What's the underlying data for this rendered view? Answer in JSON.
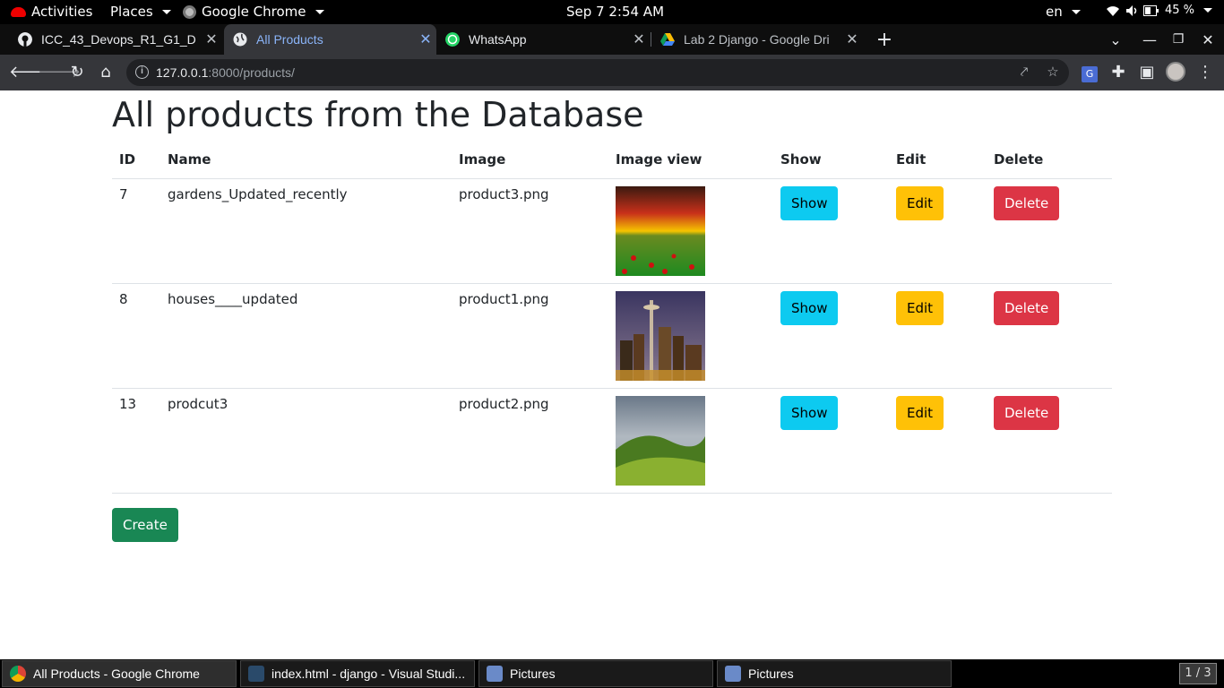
{
  "system_bar": {
    "activities": "Activities",
    "places": "Places",
    "app": "Google Chrome",
    "datetime": "Sep 7   2:54 AM",
    "language": "en",
    "battery": "45 %"
  },
  "tabs": [
    {
      "title": "ICC_43_Devops_R1_G1_D",
      "icon": "github-icon",
      "active": false
    },
    {
      "title": "All Products",
      "icon": "globe-icon",
      "active": true
    },
    {
      "title": "WhatsApp",
      "icon": "whatsapp-icon",
      "active": false
    },
    {
      "title": "Lab 2 Django - Google Dri",
      "icon": "google-drive-icon",
      "active": false
    }
  ],
  "address_bar": {
    "host": "127.0.0.1",
    "path": ":8000/products/"
  },
  "page": {
    "heading": "All products from the Database",
    "columns": [
      "ID",
      "Name",
      "Image",
      "Image view",
      "Show",
      "Edit",
      "Delete"
    ],
    "rows": [
      {
        "id": "7",
        "name": "gardens_Updated_recently",
        "image": "product3.png",
        "thumb": "sunset-poppy-field"
      },
      {
        "id": "8",
        "name": "houses____updated",
        "image": "product1.png",
        "thumb": "city-skyline-night"
      },
      {
        "id": "13",
        "name": "prodcut3",
        "image": "product2.png",
        "thumb": "green-hills"
      }
    ],
    "show_label": "Show",
    "edit_label": "Edit",
    "delete_label": "Delete",
    "create_label": "Create"
  },
  "taskbar": {
    "items": [
      {
        "label": "All Products - Google Chrome",
        "active": true
      },
      {
        "label": "index.html - django - Visual Studi...",
        "active": false
      },
      {
        "label": "Pictures",
        "active": false
      },
      {
        "label": "Pictures",
        "active": false
      }
    ],
    "workspace": "1 / 3"
  },
  "colors": {
    "show": "#0dcaf0",
    "edit": "#ffc107",
    "delete": "#dc3545",
    "create": "#198754"
  }
}
